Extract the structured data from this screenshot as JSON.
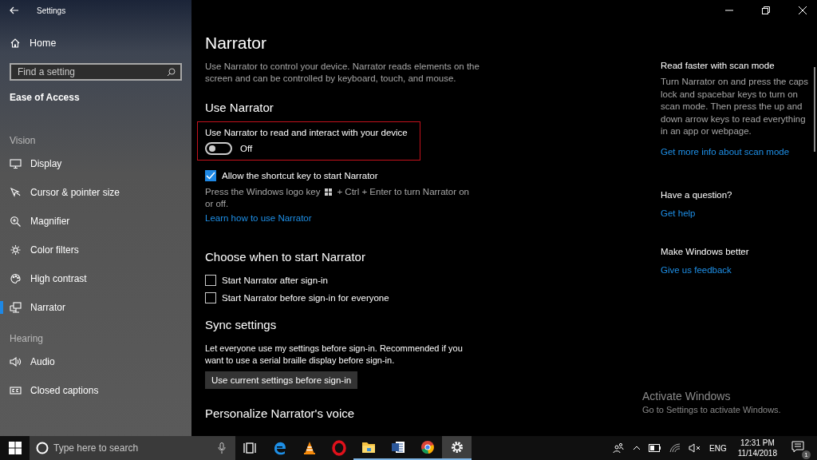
{
  "window": {
    "title": "Settings"
  },
  "sidebar": {
    "home": "Home",
    "search": {
      "placeholder": "Find a setting"
    },
    "category": "Ease of Access",
    "groups": [
      {
        "heading": "Vision",
        "items": [
          {
            "label": "Display",
            "kind": "display",
            "selected": false
          },
          {
            "label": "Cursor & pointer size",
            "kind": "cursor",
            "selected": false
          },
          {
            "label": "Magnifier",
            "kind": "magnifier",
            "selected": false
          },
          {
            "label": "Color filters",
            "kind": "sun",
            "selected": false
          },
          {
            "label": "High contrast",
            "kind": "palette",
            "selected": false
          },
          {
            "label": "Narrator",
            "kind": "narrator",
            "selected": true
          }
        ]
      },
      {
        "heading": "Hearing",
        "items": [
          {
            "label": "Audio",
            "kind": "speaker",
            "selected": false
          },
          {
            "label": "Closed captions",
            "kind": "captions",
            "selected": false
          }
        ]
      }
    ]
  },
  "page": {
    "title": "Narrator",
    "intro": "Use Narrator to control your device. Narrator reads elements on the screen and can be controlled by keyboard, touch, and mouse.",
    "use_narrator": {
      "heading": "Use Narrator",
      "toggle": {
        "label": "Use Narrator to read and interact with your device",
        "on": false,
        "state_text": "Off",
        "highlighted": true
      },
      "shortcut": {
        "label": "Allow the shortcut key to start Narrator",
        "checked": true
      },
      "hint_before": "Press the Windows logo key",
      "hint_after": "+ Ctrl + Enter to turn Narrator on",
      "hint_continued": "or off.",
      "link": "Learn how to use Narrator"
    },
    "start": {
      "heading": "Choose when to start Narrator",
      "options": [
        {
          "label": "Start Narrator after sign-in",
          "checked": false
        },
        {
          "label": "Start Narrator before sign-in for everyone",
          "checked": false
        }
      ]
    },
    "sync": {
      "heading": "Sync settings",
      "text": "Let everyone use my settings before sign-in. Recommended if you want to use a serial braille display before sign-in.",
      "button": "Use current settings before sign-in"
    },
    "next_heading": "Personalize Narrator's voice"
  },
  "aside": [
    {
      "heading": "Read faster with scan mode",
      "text": "Turn Narrator on and press the caps lock and spacebar keys to turn on scan mode. Then press the up and down arrow keys to read everything in an app or webpage.",
      "link": "Get more info about scan mode"
    },
    {
      "heading": "Have a question?",
      "link": "Get help"
    },
    {
      "heading": "Make Windows better",
      "link": "Give us feedback"
    }
  ],
  "activation": {
    "title": "Activate Windows",
    "text": "Go to Settings to activate Windows."
  },
  "taskbar": {
    "search": {
      "placeholder": "Type here to search"
    },
    "apps": [
      {
        "kind": "taskview",
        "running": false,
        "active": false
      },
      {
        "kind": "edge",
        "running": false,
        "active": false
      },
      {
        "kind": "cone",
        "running": false,
        "active": false
      },
      {
        "kind": "opera",
        "running": false,
        "active": false
      },
      {
        "kind": "folder",
        "running": true,
        "active": false
      },
      {
        "kind": "word",
        "running": true,
        "active": false
      },
      {
        "kind": "chrome",
        "running": true,
        "active": false
      },
      {
        "kind": "gear",
        "running": true,
        "active": true
      }
    ],
    "language": "ENG",
    "time": "12:31 PM",
    "date": "11/14/2018",
    "notifications": "1"
  }
}
